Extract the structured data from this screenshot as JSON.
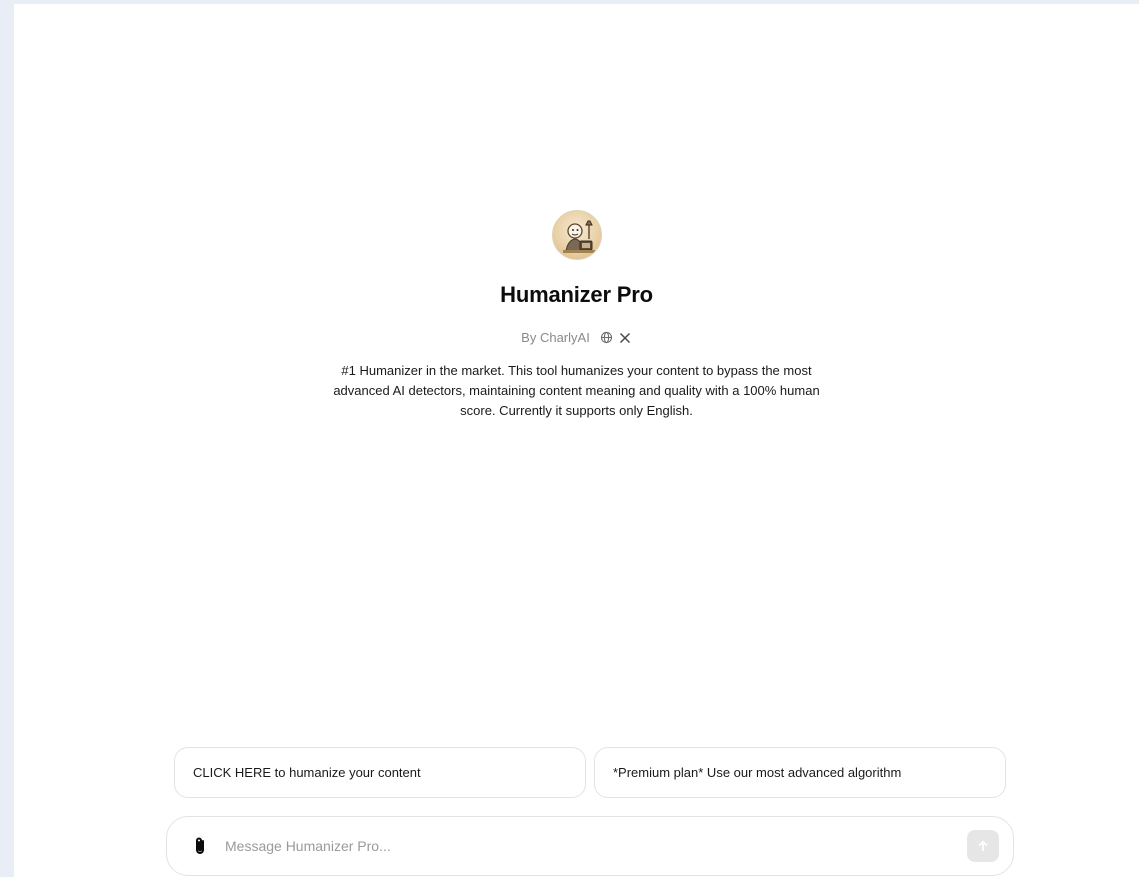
{
  "gpt": {
    "title": "Humanizer Pro",
    "byline": "By CharlyAI",
    "description": "#1 Humanizer in the market. This tool humanizes your content to bypass the most advanced AI detectors, maintaining content meaning and quality with a 100% human score. Currently it supports only English.",
    "avatar_icon": "humanizer-pro-avatar"
  },
  "byline_icons": [
    "globe-icon",
    "x-logo-icon"
  ],
  "suggestions": [
    {
      "label": "CLICK HERE to humanize your content"
    },
    {
      "label": "*Premium plan* Use our most advanced algorithm"
    }
  ],
  "composer": {
    "placeholder": "Message Humanizer Pro...",
    "attach_icon": "paperclip-icon",
    "send_icon": "arrow-up-icon"
  },
  "colors": {
    "background": "#e9eef6",
    "surface": "#ffffff",
    "border": "#e3e3e3",
    "muted_text": "#8a8a8a",
    "send_button_disabled": "#e6e6e6"
  }
}
